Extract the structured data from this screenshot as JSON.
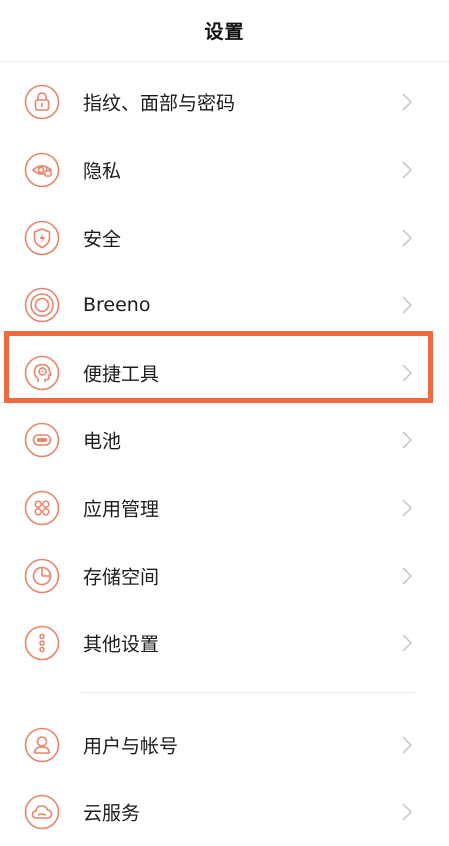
{
  "header": {
    "title": "设置"
  },
  "accent_color": "#e9836a",
  "highlight_color": "#ef6a3f",
  "menu": [
    {
      "label": "指纹、面部与密码",
      "icon": "lock-icon"
    },
    {
      "label": "隐私",
      "icon": "privacy-eye-icon"
    },
    {
      "label": "安全",
      "icon": "shield-icon"
    },
    {
      "label": "Breeno",
      "icon": "breeno-rings-icon"
    },
    {
      "label": "便捷工具",
      "icon": "head-tools-icon",
      "highlighted": true
    },
    {
      "label": "电池",
      "icon": "battery-icon"
    },
    {
      "label": "应用管理",
      "icon": "apps-grid-icon"
    },
    {
      "label": "存储空间",
      "icon": "storage-pie-icon"
    },
    {
      "label": "其他设置",
      "icon": "more-dots-icon"
    },
    {
      "label": "用户与帐号",
      "icon": "user-icon"
    },
    {
      "label": "云服务",
      "icon": "cloud-icon"
    }
  ]
}
